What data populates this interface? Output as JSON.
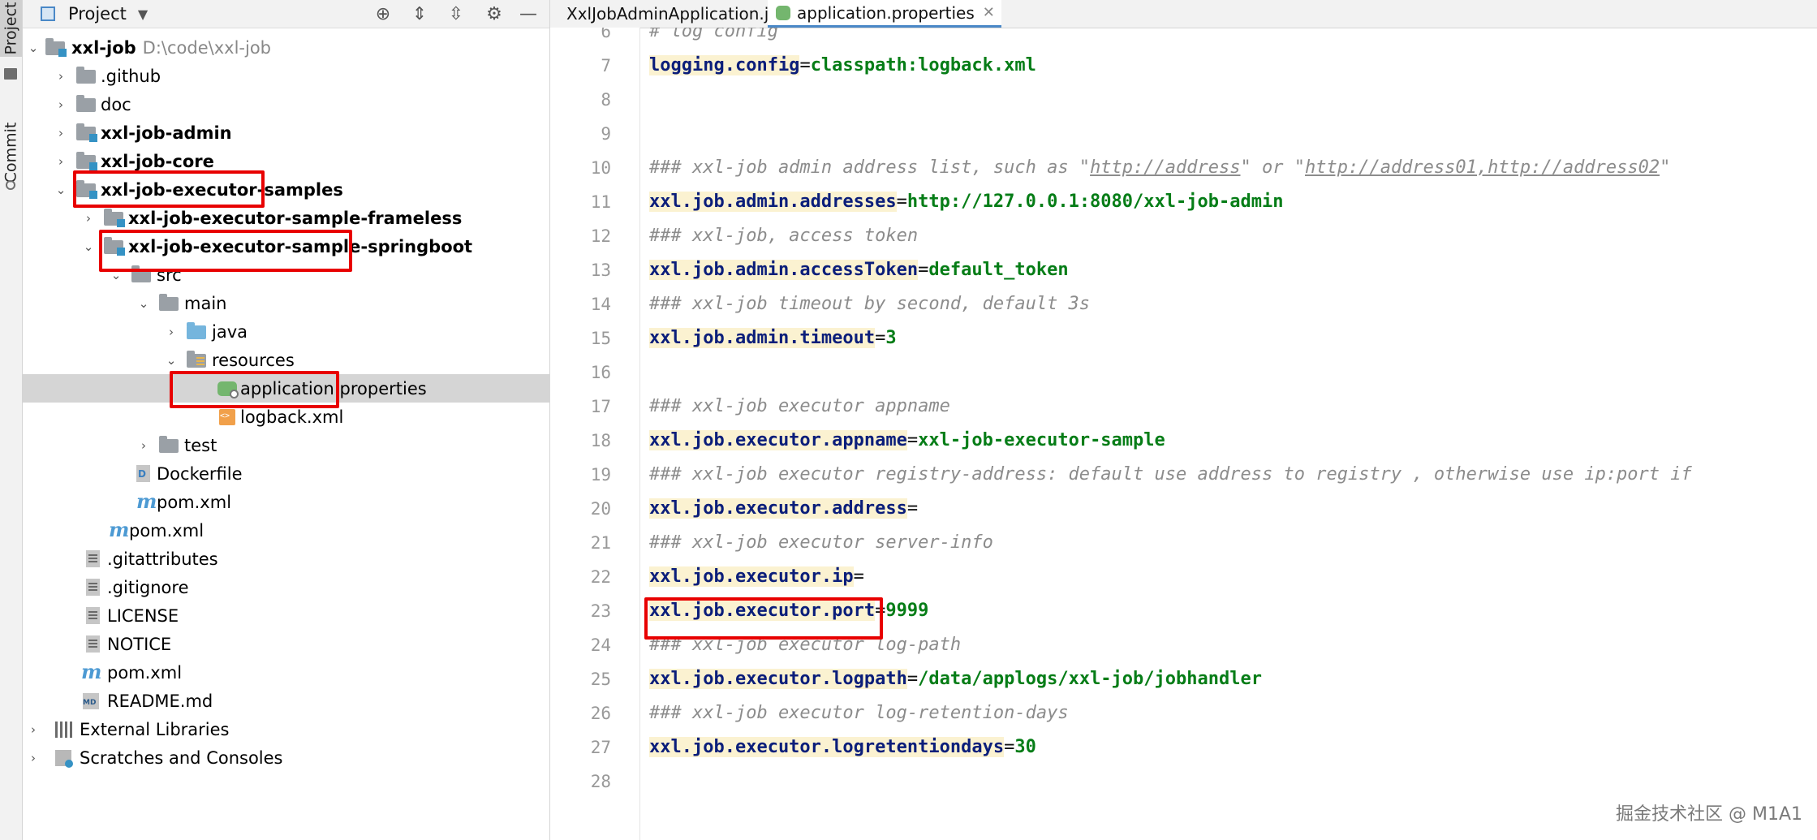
{
  "tool_strip": {
    "project_tab": "Project",
    "commit_tab": "Commit"
  },
  "panel": {
    "title": "Project"
  },
  "tree": {
    "root_label": "xxl-job",
    "root_path": "D:\\code\\xxl-job",
    "github": ".github",
    "doc": "doc",
    "admin": "xxl-job-admin",
    "core": "xxl-job-core",
    "samples": "xxl-job-executor-samples",
    "frameless": "xxl-job-executor-sample-frameless",
    "springboot": "xxl-job-executor-sample-springboot",
    "src": "src",
    "main": "main",
    "java": "java",
    "resources": "resources",
    "app_props": "application.properties",
    "logback": "logback.xml",
    "test": "test",
    "dockerfile": "Dockerfile",
    "pom1": "pom.xml",
    "pom2": "pom.xml",
    "gitattributes": ".gitattributes",
    "gitignore": ".gitignore",
    "license": "LICENSE",
    "notice": "NOTICE",
    "pom3": "pom.xml",
    "readme": "README.md",
    "ext_libs": "External Libraries",
    "scratches": "Scratches and Consoles"
  },
  "tabs": {
    "java_tab": "XxlJobAdminApplication.java",
    "props_tab": "application.properties"
  },
  "code": {
    "l6_num": "6",
    "l6_c": "# log config",
    "l7_num": "7",
    "l7_k": "logging.config",
    "l7_v": "classpath:logback.xml",
    "l8_num": "8",
    "l9_num": "9",
    "l10_num": "10",
    "l10_a": "### xxl-job admin address list, such as \"",
    "l10_u1": "http://address",
    "l10_b": "\" or \"",
    "l10_u2": "http://address01,http://address02",
    "l10_c": "\"",
    "l11_num": "11",
    "l11_k": "xxl.job.admin.addresses",
    "l11_v": "http://127.0.0.1:8080/xxl-job-admin",
    "l12_num": "12",
    "l12_c": "### xxl-job, access token",
    "l13_num": "13",
    "l13_k": "xxl.job.admin.accessToken",
    "l13_v": "default_token",
    "l14_num": "14",
    "l14_c": "### xxl-job timeout by second, default 3s",
    "l15_num": "15",
    "l15_k": "xxl.job.admin.timeout",
    "l15_v": "3",
    "l16_num": "16",
    "l17_num": "17",
    "l17_c": "### xxl-job executor appname",
    "l18_num": "18",
    "l18_k": "xxl.job.executor.appname",
    "l18_v": "xxl-job-executor-sample",
    "l19_num": "19",
    "l19_c": "### xxl-job executor registry-address: default use address to registry , otherwise use ip:port if",
    "l20_num": "20",
    "l20_k": "xxl.job.executor.address",
    "l20_v": "",
    "l21_num": "21",
    "l21_c": "### xxl-job executor server-info",
    "l22_num": "22",
    "l22_k": "xxl.job.executor.ip",
    "l22_v": "",
    "l23_num": "23",
    "l23_k": "xxl.job.executor.port",
    "l23_v": "9999",
    "l24_num": "24",
    "l24_c": "### xxl-job executor log-path",
    "l25_num": "25",
    "l25_k": "xxl.job.executor.logpath",
    "l25_v": "/data/applogs/xxl-job/jobhandler",
    "l26_num": "26",
    "l26_c": "### xxl-job executor log-retention-days",
    "l27_num": "27",
    "l27_k": "xxl.job.executor.logretentiondays",
    "l27_v": "30",
    "l28_num": "28",
    "eq": "="
  },
  "watermark": "掘金技术社区 @ M1A1"
}
